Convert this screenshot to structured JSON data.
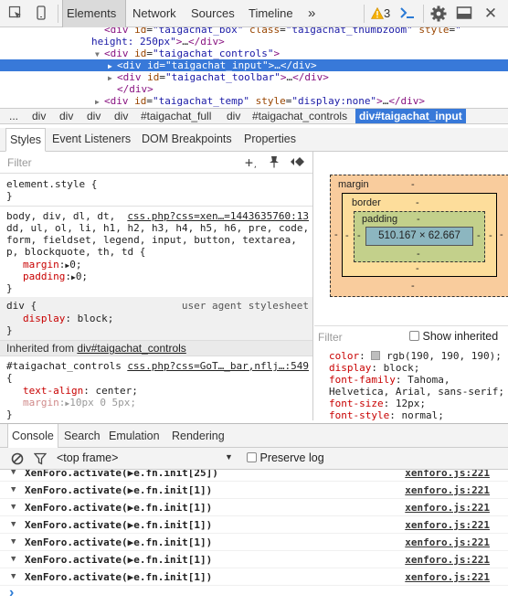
{
  "toolbar": {
    "tabs": [
      "Elements",
      "Network",
      "Sources",
      "Timeline"
    ],
    "more": "»",
    "warning_count": "3",
    "warning_icon": "warning-icon",
    "console_icon": "console-prompt-icon",
    "settings_icon": "gear-icon",
    "dock_icon": "dock-icon",
    "close_icon": "close-icon"
  },
  "dom": {
    "lines": [
      {
        "indent": 8,
        "tri": "",
        "html": "<span class='tag'>&lt;div</span> <span class='attr'>id</span>=<span class='val'>\"taigachat_box\"</span> <span class='attr'>class</span>=<span class='val'>\"taigachat_thumbzoom\"</span> <span class='attr'>style</span>=<span class='val'>\"</span>"
      },
      {
        "indent": 7,
        "tri": "",
        "html": "<span class='val'>height: 250px\"</span><span class='tag'>&gt;</span>…<span class='tag'>&lt;/div&gt;</span>"
      },
      {
        "indent": 8,
        "tri": "▼",
        "html": "<span class='tag'>&lt;div</span> <span class='attr'>id</span>=<span class='val'>\"taigachat_controls\"</span><span class='tag'>&gt;</span>"
      },
      {
        "indent": 9,
        "tri": "▶",
        "html": "<span class='tag'>&lt;div</span> <span class='attr'>id</span>=<span class='val'>\"taigachat_input\"</span><span class='tag'>&gt;</span>…<span class='tag'>&lt;/div&gt;</span>",
        "selected": true
      },
      {
        "indent": 9,
        "tri": "▶",
        "html": "<span class='tag'>&lt;div</span> <span class='attr'>id</span>=<span class='val'>\"taigachat_toolbar\"</span><span class='tag'>&gt;</span>…<span class='tag'>&lt;/div&gt;</span>"
      },
      {
        "indent": 9,
        "tri": "",
        "html": "<span class='tag'>&lt;/div&gt;</span>"
      },
      {
        "indent": 8,
        "tri": "▶",
        "html": "<span class='tag'>&lt;div</span> <span class='attr'>id</span>=<span class='val'>\"taigachat_temp\"</span> <span class='attr'>style</span>=<span class='val'>\"display:none\"</span><span class='tag'>&gt;</span>…<span class='tag'>&lt;/div&gt;</span>"
      }
    ]
  },
  "breadcrumbs": [
    "...",
    "div",
    "div",
    "div",
    "div",
    "#taigachat_full",
    "div",
    "#taigachat_controls",
    "div#taigachat_input"
  ],
  "subtabs": [
    "Styles",
    "Event Listeners",
    "DOM Breakpoints",
    "Properties"
  ],
  "styles": {
    "filter_placeholder": "Filter",
    "add_rule_icon": "plus-icon",
    "pin_icon": "pin-icon",
    "toggle_icon": "color-format-icon",
    "element_style": "element.style {",
    "close_brace": "}",
    "rule1_selector_1": "body, div, dl, dt,",
    "rule1_source": "css.php?css=xen…=1443635760:13",
    "rule1_selector_2": "dd, ul, ol, li, h1, h2, h3, h4, h5, h6, pre, code,",
    "rule1_selector_3": "form, fieldset, legend, input, button, textarea,",
    "rule1_selector_4": "p, blockquote, th, td {",
    "rule1_prop1_name": "margin",
    "rule1_prop1_val": "0;",
    "rule1_prop2_name": "padding",
    "rule1_prop2_val": "0;",
    "rule2_selector": "div {",
    "rule2_source": "user agent stylesheet",
    "rule2_prop_name": "display",
    "rule2_prop_val": "block;",
    "inherited_label": "Inherited from",
    "inherited_link": "div#taigachat_controls",
    "rule3_selector": "#taigachat_controls",
    "rule3_source": "css.php?css=GoT…_bar,nflj…:549",
    "rule3_open": "{",
    "rule3_prop1_name": "text-align",
    "rule3_prop1_val": "center;",
    "rule3_prop2_name": "margin",
    "rule3_prop2_val": "10px 0 5px;"
  },
  "boxmodel": {
    "margin_label": "margin",
    "border_label": "border",
    "padding_label": "padding",
    "content": "510.167 × 62.667",
    "dash": "-"
  },
  "computed": {
    "filter_placeholder": "Filter",
    "show_inherited": "Show inherited",
    "color_name": "color",
    "color_val": "rgb(190, 190, 190);",
    "swatch_color": "#bebebe",
    "display_name": "display",
    "display_val": "block;",
    "ff_name": "font-family",
    "ff_val1": "Tahoma,",
    "ff_val2": "Helvetica, Arial, sans-serif;",
    "fs_name": "font-size",
    "fs_val": "12px;",
    "fst_name": "font-style",
    "fst_val": "normal;"
  },
  "drawer": {
    "tabs": [
      "Console",
      "Search",
      "Emulation",
      "Rendering"
    ],
    "frame_select": "<top frame>",
    "preserve_log": "Preserve log",
    "clear_icon": "clear-console-icon",
    "filter_icon": "funnel-icon"
  },
  "console": {
    "lines": [
      {
        "text": "XenForo.activate(▶e.fn.init[25])",
        "src": "xenforo.js:221"
      },
      {
        "text": "XenForo.activate(▶e.fn.init[1])",
        "src": "xenforo.js:221"
      },
      {
        "text": "XenForo.activate(▶e.fn.init[1])",
        "src": "xenforo.js:221"
      },
      {
        "text": "XenForo.activate(▶e.fn.init[1])",
        "src": "xenforo.js:221"
      },
      {
        "text": "XenForo.activate(▶e.fn.init[1])",
        "src": "xenforo.js:221"
      },
      {
        "text": "XenForo.activate(▶e.fn.init[1])",
        "src": "xenforo.js:221"
      },
      {
        "text": "XenForo.activate(▶e.fn.init[1])",
        "src": "xenforo.js:221"
      }
    ],
    "prompt": "›"
  }
}
